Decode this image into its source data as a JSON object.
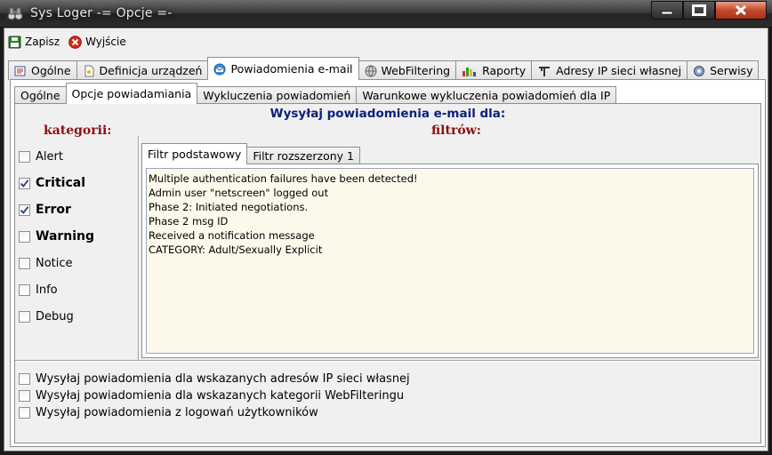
{
  "window": {
    "title": "Sys Loger -= Opcje =-",
    "app_icon": "binoculars-icon",
    "controls": [
      "minimize-icon",
      "maximize-icon",
      "close-icon"
    ]
  },
  "toolbar": {
    "save": {
      "label": "Zapisz",
      "icon": "floppy-disk-icon"
    },
    "exit": {
      "label": "Wyjście",
      "icon": "red-x-icon"
    }
  },
  "main_tabs": [
    {
      "label": "Ogólne",
      "icon": "settings-icon",
      "active": false
    },
    {
      "label": "Definicja urządzeń",
      "icon": "document-icon",
      "active": false
    },
    {
      "label": "Powiadomienia e-mail",
      "icon": "email-icon",
      "active": true
    },
    {
      "label": "WebFiltering",
      "icon": "globe-icon",
      "active": false
    },
    {
      "label": "Raporty",
      "icon": "chart-icon",
      "active": false
    },
    {
      "label": "Adresy IP sieci własnej",
      "icon": "network-icon",
      "active": false
    },
    {
      "label": "Serwisy",
      "icon": "gear-icon",
      "active": false
    }
  ],
  "sub_tabs": [
    {
      "label": "Ogólne",
      "active": false
    },
    {
      "label": "Opcje powiadamiania",
      "active": true
    },
    {
      "label": "Wykluczenia powiadomień",
      "active": false
    },
    {
      "label": "Warunkowe wykluczenia powiadomień dla IP",
      "active": false
    }
  ],
  "panel": {
    "title": "Wysyłaj powiadomienia e-mail dla:",
    "categories_label": "kategorii:",
    "filters_label": "filtrów:"
  },
  "categories": [
    {
      "label": "Alert",
      "checked": false,
      "bold": false
    },
    {
      "label": "Critical",
      "checked": true,
      "bold": true
    },
    {
      "label": "Error",
      "checked": true,
      "bold": true
    },
    {
      "label": "Warning",
      "checked": false,
      "bold": true
    },
    {
      "label": "Notice",
      "checked": false,
      "bold": false
    },
    {
      "label": "Info",
      "checked": false,
      "bold": false
    },
    {
      "label": "Debug",
      "checked": false,
      "bold": false
    }
  ],
  "filter_tabs": [
    {
      "label": "Filtr podstawowy",
      "active": true
    },
    {
      "label": "Filtr rozszerzony 1",
      "active": false
    }
  ],
  "filter_text": [
    "Multiple authentication failures have been detected!",
    "Admin user \"netscreen\" logged out",
    "Phase 2: Initiated negotiations.",
    "Phase 2 msg ID",
    "Received a notification message",
    "CATEGORY: Adult/Sexually Explicit"
  ],
  "options": [
    {
      "label": "Wysyłaj powiadomienia dla wskazanych adresów IP sieci własnej",
      "checked": false
    },
    {
      "label": "Wysyłaj powiadomienia dla wskazanych kategorii WebFilteringu",
      "checked": false
    },
    {
      "label": "Wysyłaj powiadomienia z logowań użytkowników",
      "checked": false
    }
  ],
  "colors": {
    "panel_title": "#0a1f7a",
    "section_label": "#8a1010",
    "memo_background": "#fdf9ea"
  }
}
